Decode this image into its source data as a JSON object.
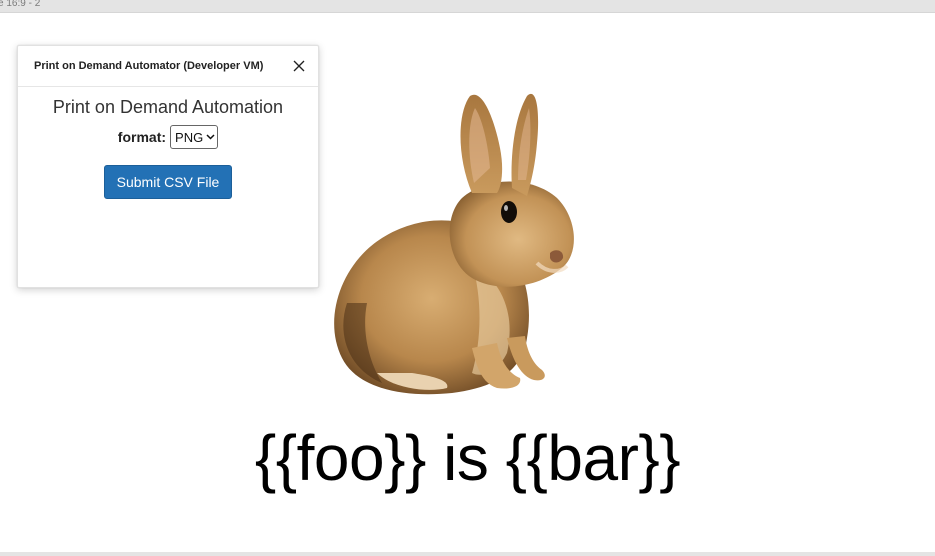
{
  "frame": {
    "label": "e 16:9 - 2"
  },
  "plugin": {
    "window_title": "Print on Demand Automator (Developer VM)",
    "heading": "Print on Demand Automation",
    "format_label": "format:",
    "format_value": "PNG",
    "submit_label": "Submit CSV File"
  },
  "canvas": {
    "caption": "{{foo}} is {{bar}}",
    "image": "rabbit-photo"
  },
  "colors": {
    "button": "#2371b5",
    "rabbit_fur": "#b88a50"
  }
}
